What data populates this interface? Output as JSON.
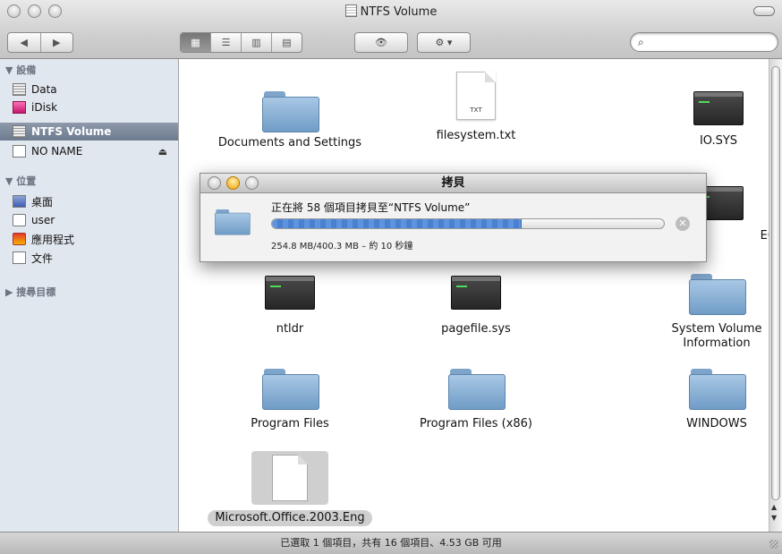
{
  "window": {
    "title": "NTFS Volume"
  },
  "toolbar": {
    "back_icon": "◀",
    "forward_icon": "▶",
    "view_icon": "👁",
    "action_icon": "⚙ ▾",
    "search_icon": "⌕"
  },
  "sidebar": {
    "devices_header": "▼ 設備",
    "places_header": "▼ 位置",
    "search_header": "▶ 搜尋目標",
    "devices": [
      {
        "label": "Data",
        "icon": "disk-icon"
      },
      {
        "label": "iDisk",
        "icon": "idisk-icon"
      },
      {
        "label": "NTFS Volume",
        "icon": "disk-icon",
        "selected": true
      },
      {
        "label": "NO NAME",
        "icon": "removable-disk-icon",
        "eject": "⏏"
      }
    ],
    "places": [
      {
        "label": "桌面",
        "icon": "desktop-icon"
      },
      {
        "label": "user",
        "icon": "home-icon"
      },
      {
        "label": "應用程式",
        "icon": "applications-icon"
      },
      {
        "label": "文件",
        "icon": "documents-icon"
      }
    ]
  },
  "files": [
    {
      "name": "Documents and Settings",
      "type": "folder"
    },
    {
      "name": "filesystem.txt",
      "type": "text",
      "badge": "TXT"
    },
    {
      "name": "IO.SYS",
      "type": "system"
    },
    {
      "name": "ECT.COM",
      "type": "system"
    },
    {
      "name": "ntldr",
      "type": "system"
    },
    {
      "name": "pagefile.sys",
      "type": "system"
    },
    {
      "name": "System Volume Information",
      "type": "folder"
    },
    {
      "name": "Program Files",
      "type": "folder"
    },
    {
      "name": "Program Files (x86)",
      "type": "folder"
    },
    {
      "name": "WINDOWS",
      "type": "folder"
    },
    {
      "name": "Microsoft.Office.2003.Eng",
      "type": "document",
      "selected": true
    }
  ],
  "copy_dialog": {
    "title": "拷貝",
    "message": "正在將 58 個項目拷貝至“NTFS Volume”",
    "progress_fraction": 0.636,
    "detail": "254.8 MB/400.3 MB – 約 10 秒鐘",
    "stop_icon": "✕"
  },
  "status_bar": {
    "text": "已選取 1 個項目，共有 16 個項目、4.53 GB 可用"
  }
}
